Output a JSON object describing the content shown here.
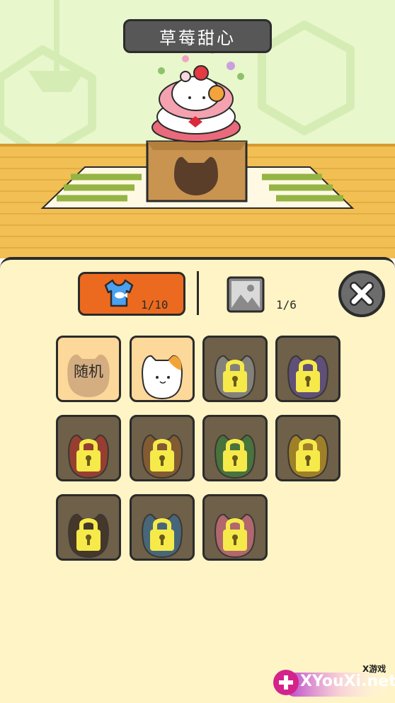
{
  "scene": {
    "title": "草莓甜心"
  },
  "tabs": {
    "outfit": {
      "count": "1/10",
      "icon": "tshirt-icon",
      "selected": true
    },
    "background": {
      "count": "1/6",
      "icon": "picture-icon",
      "selected": false
    }
  },
  "close": {
    "icon": "close-icon"
  },
  "skins": [
    {
      "label": "随机",
      "state": "unlocked",
      "kind": "random"
    },
    {
      "label": "",
      "state": "unlocked",
      "kind": "calico-cat"
    },
    {
      "label": "",
      "state": "locked",
      "kind": "astronaut-cat"
    },
    {
      "label": "",
      "state": "locked",
      "kind": "unicorn-cat"
    },
    {
      "label": "",
      "state": "locked",
      "kind": "red-cat"
    },
    {
      "label": "",
      "state": "locked",
      "kind": "detective-cat"
    },
    {
      "label": "",
      "state": "locked",
      "kind": "broccoli-cat"
    },
    {
      "label": "",
      "state": "locked",
      "kind": "bee-cat"
    },
    {
      "label": "",
      "state": "locked",
      "kind": "guard-cat"
    },
    {
      "label": "",
      "state": "locked",
      "kind": "worker-cat"
    },
    {
      "label": "",
      "state": "locked",
      "kind": "strawberry-cat"
    }
  ],
  "watermark": {
    "text": "XYouXi.net",
    "small": "X游戏"
  },
  "colors": {
    "accent": "#ec6a1f",
    "panel": "#fff4c6",
    "lock": "#f5ea4a"
  }
}
